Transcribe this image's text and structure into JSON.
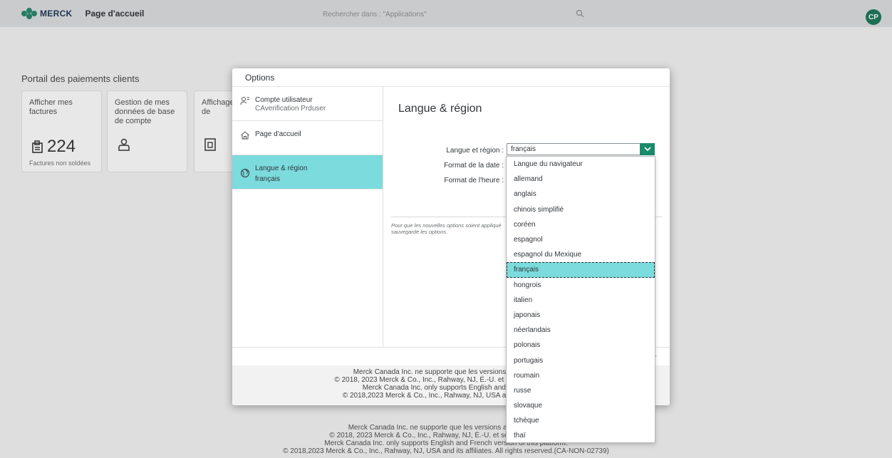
{
  "shell": {
    "logo": "MERCK",
    "title": "Page d'accueil",
    "search_placeholder": "Rechercher dans : \"Applications\"",
    "avatar": "CP"
  },
  "page": {
    "section_title": "Portail des paiements clients",
    "tiles": [
      {
        "title": "Afficher mes factures",
        "kpi": "224",
        "footer": "Factures non soldées"
      },
      {
        "title": "Gestion de mes données de base de compte"
      },
      {
        "title": "Affichage extrait de"
      }
    ],
    "footer_lines": [
      "Merck Canada Inc. ne supporte que les versions anglaise et fr",
      "© 2018, 2023 Merck & Co., Inc., Rahway, NJ, É.-U. et ses sociétés affiliée",
      "Merck Canada Inc. only supports English and French version of this platform.",
      "© 2018,2023 Merck & Co., Inc., Rahway, NJ, USA and its affiliates. All rights reserved.(CA-NON-02739)"
    ]
  },
  "dialog": {
    "title": "Options",
    "nav": [
      {
        "label": "Compte utilisateur",
        "sub": "CAverification Prduser",
        "icon": "user-settings-icon"
      },
      {
        "label": "Page d'accueil",
        "sub": "",
        "icon": "home-icon"
      },
      {
        "label": "Langue & région",
        "sub": "français",
        "icon": "globe-icon"
      }
    ],
    "section_title": "Langue & région",
    "fields": {
      "language_label": "Langue et région :",
      "language_value": "français",
      "date_label": "Format de la date :",
      "time_label": "Format de l'heure :"
    },
    "note": "Pour que les nouvelles options soient appliqué sauvegardé les options.",
    "footer_link": "r",
    "legal_lines": [
      "Merck Canada Inc. ne supporte que les versions anglaise et fr",
      "© 2018, 2023 Merck & Co., Inc., Rahway, NJ, É.-U. et ses sociétés affiliée",
      "Merck Canada Inc. only supports English and French ve",
      "© 2018,2023 Merck & Co., Inc., Rahway, NJ, USA and its affiliates. A"
    ]
  },
  "dropdown": {
    "selected": "français",
    "options": [
      "Langue du navigateur",
      "allemand",
      "anglais",
      "chinois simplifié",
      "coréen",
      "espagnol",
      "espagnol du Mexique",
      "français",
      "hongrois",
      "italien",
      "japonais",
      "néerlandais",
      "polonais",
      "portugais",
      "roumain",
      "russe",
      "slovaque",
      "tchèque",
      "thaï"
    ]
  },
  "colors": {
    "accent": "#1a8a6d",
    "selection": "#7bdbdd",
    "avatar": "#1f7a5c"
  }
}
